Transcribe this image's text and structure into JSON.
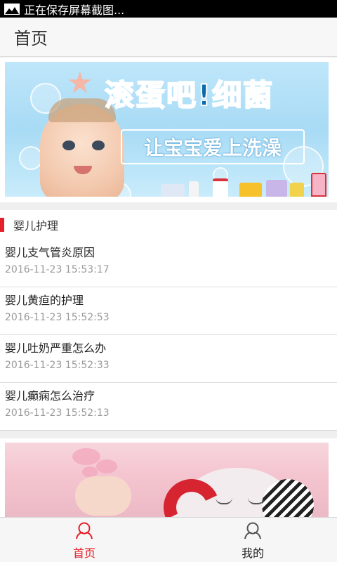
{
  "status_bar": {
    "notification_text": "正在保存屏幕截图...",
    "icon": "image-icon"
  },
  "header": {
    "title": "首页"
  },
  "banner_top": {
    "headline": "滚蛋吧!细菌",
    "subline": "让宝宝爱上洗澡"
  },
  "section": {
    "title": "婴儿护理",
    "accent_color": "#e5202a",
    "items": [
      {
        "title": "婴儿支气管炎原因",
        "time": "2016-11-23 15:53:17"
      },
      {
        "title": "婴儿黄疸的护理",
        "time": "2016-11-23 15:52:53"
      },
      {
        "title": "婴儿吐奶严重怎么办",
        "time": "2016-11-23 15:52:33"
      },
      {
        "title": "婴儿癫痫怎么治疗",
        "time": "2016-11-23 15:52:13"
      }
    ]
  },
  "tabs": [
    {
      "label": "首页",
      "icon": "person-icon",
      "active": true,
      "color": "#e5202a"
    },
    {
      "label": "我的",
      "icon": "person-icon",
      "active": false,
      "color": "#222222"
    }
  ]
}
